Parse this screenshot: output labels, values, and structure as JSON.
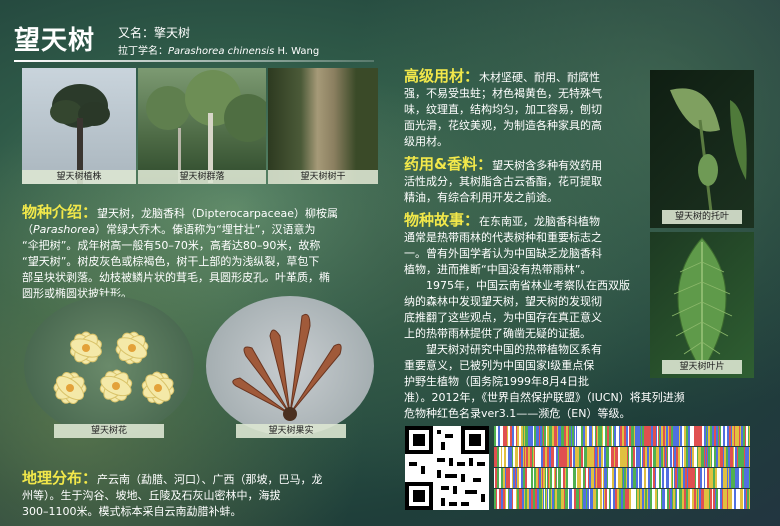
{
  "header": {
    "title": "望天树",
    "alias_label": "又名：擎天树",
    "latin_prefix": "拉丁学名：",
    "latin_name": "Parashorea chinensis",
    "latin_author": " H. Wang"
  },
  "photos": {
    "p1_caption": "望天树植株",
    "p2_caption": "望天树群落",
    "p3_caption": "望天树树干",
    "flower_caption": "望天树花",
    "fruit_caption": "望天树果实",
    "stipule_caption": "望天树的托叶",
    "leaf_caption": "望天树叶片"
  },
  "species_intro": {
    "heading": "物种介绍：",
    "line1": "望天树，龙脑香科（Dipterocarpaceae）柳桉属",
    "line2a": "（",
    "line2_italic": "Parashorea",
    "line2b": "）常绿大乔木。傣语称为“埋甘壮”，汉语意为",
    "line3": "“伞把树”。成年树高一般有50–70米，高者达80–90米，故称",
    "line4": "“望天树”。树皮灰色或棕褐色，树干上部的为浅纵裂，草包下",
    "line5": "部呈块状剥落。幼枝被鳞片状的茸毛，具圆形皮孔。叶革质，椭",
    "line6": "圆形或椭圆状披针形。"
  },
  "distribution": {
    "heading": "地理分布：",
    "line1": "产云南（勐腊、河口）、广西（那坡，巴马，龙",
    "line2": "州等）。生于沟谷、坡地、丘陵及石灰山密林中，海拔",
    "line3": "300–1100米。模式标本采自云南勐腊补蚌。"
  },
  "timber": {
    "heading": "高级用材：",
    "line1": "木材坚硬、耐用、耐腐性",
    "line2": "强，不易受虫蛀；材色褐黄色，无特殊气",
    "line3": "味，纹理直，结构均匀，加工容易，刨切",
    "line4": "面光滑，花纹美观，为制造各种家具的高",
    "line5": "级用材。"
  },
  "medicinal": {
    "heading": "药用&香料：",
    "line1": "望天树含多种有效药用",
    "line2": "活性成分，其树脂含古云香酯，花可提取",
    "line3": "精油，有综合利用开发之前途。"
  },
  "story": {
    "heading": "物种故事：",
    "line1": "在东南亚，龙脑香科植物",
    "line2": "通常是热带雨林的代表树种和重要标志之",
    "line3": "一。曾有外国学者认为中国缺乏龙脑香科",
    "line4": "植物，进而推断“中国没有热带雨林”。",
    "line5": "1975年，中国云南省林业考察队在西双版",
    "line6": "纳的森林中发现望天树，望天树的发现彻",
    "line7": "底推翻了这些观点，为中国存在真正意义",
    "line8": "上的热带雨林提供了确凿无疑的证据。",
    "line9": "望天树对研究中国的热带植物区系有",
    "line10": "重要意义，已被列为中国国家Ⅰ级重点保",
    "line11": "护野生植物（国务院1999年8月4日批",
    "line12": "准）。2012年，《世界自然保护联盟》（IUCN）将其列进濒",
    "line13": "危物种红色名录ver3.1——濒危（EN）等级。"
  },
  "colors": {
    "accent_heading": "#f2e84a",
    "caption_bg": "#dce6d2"
  }
}
